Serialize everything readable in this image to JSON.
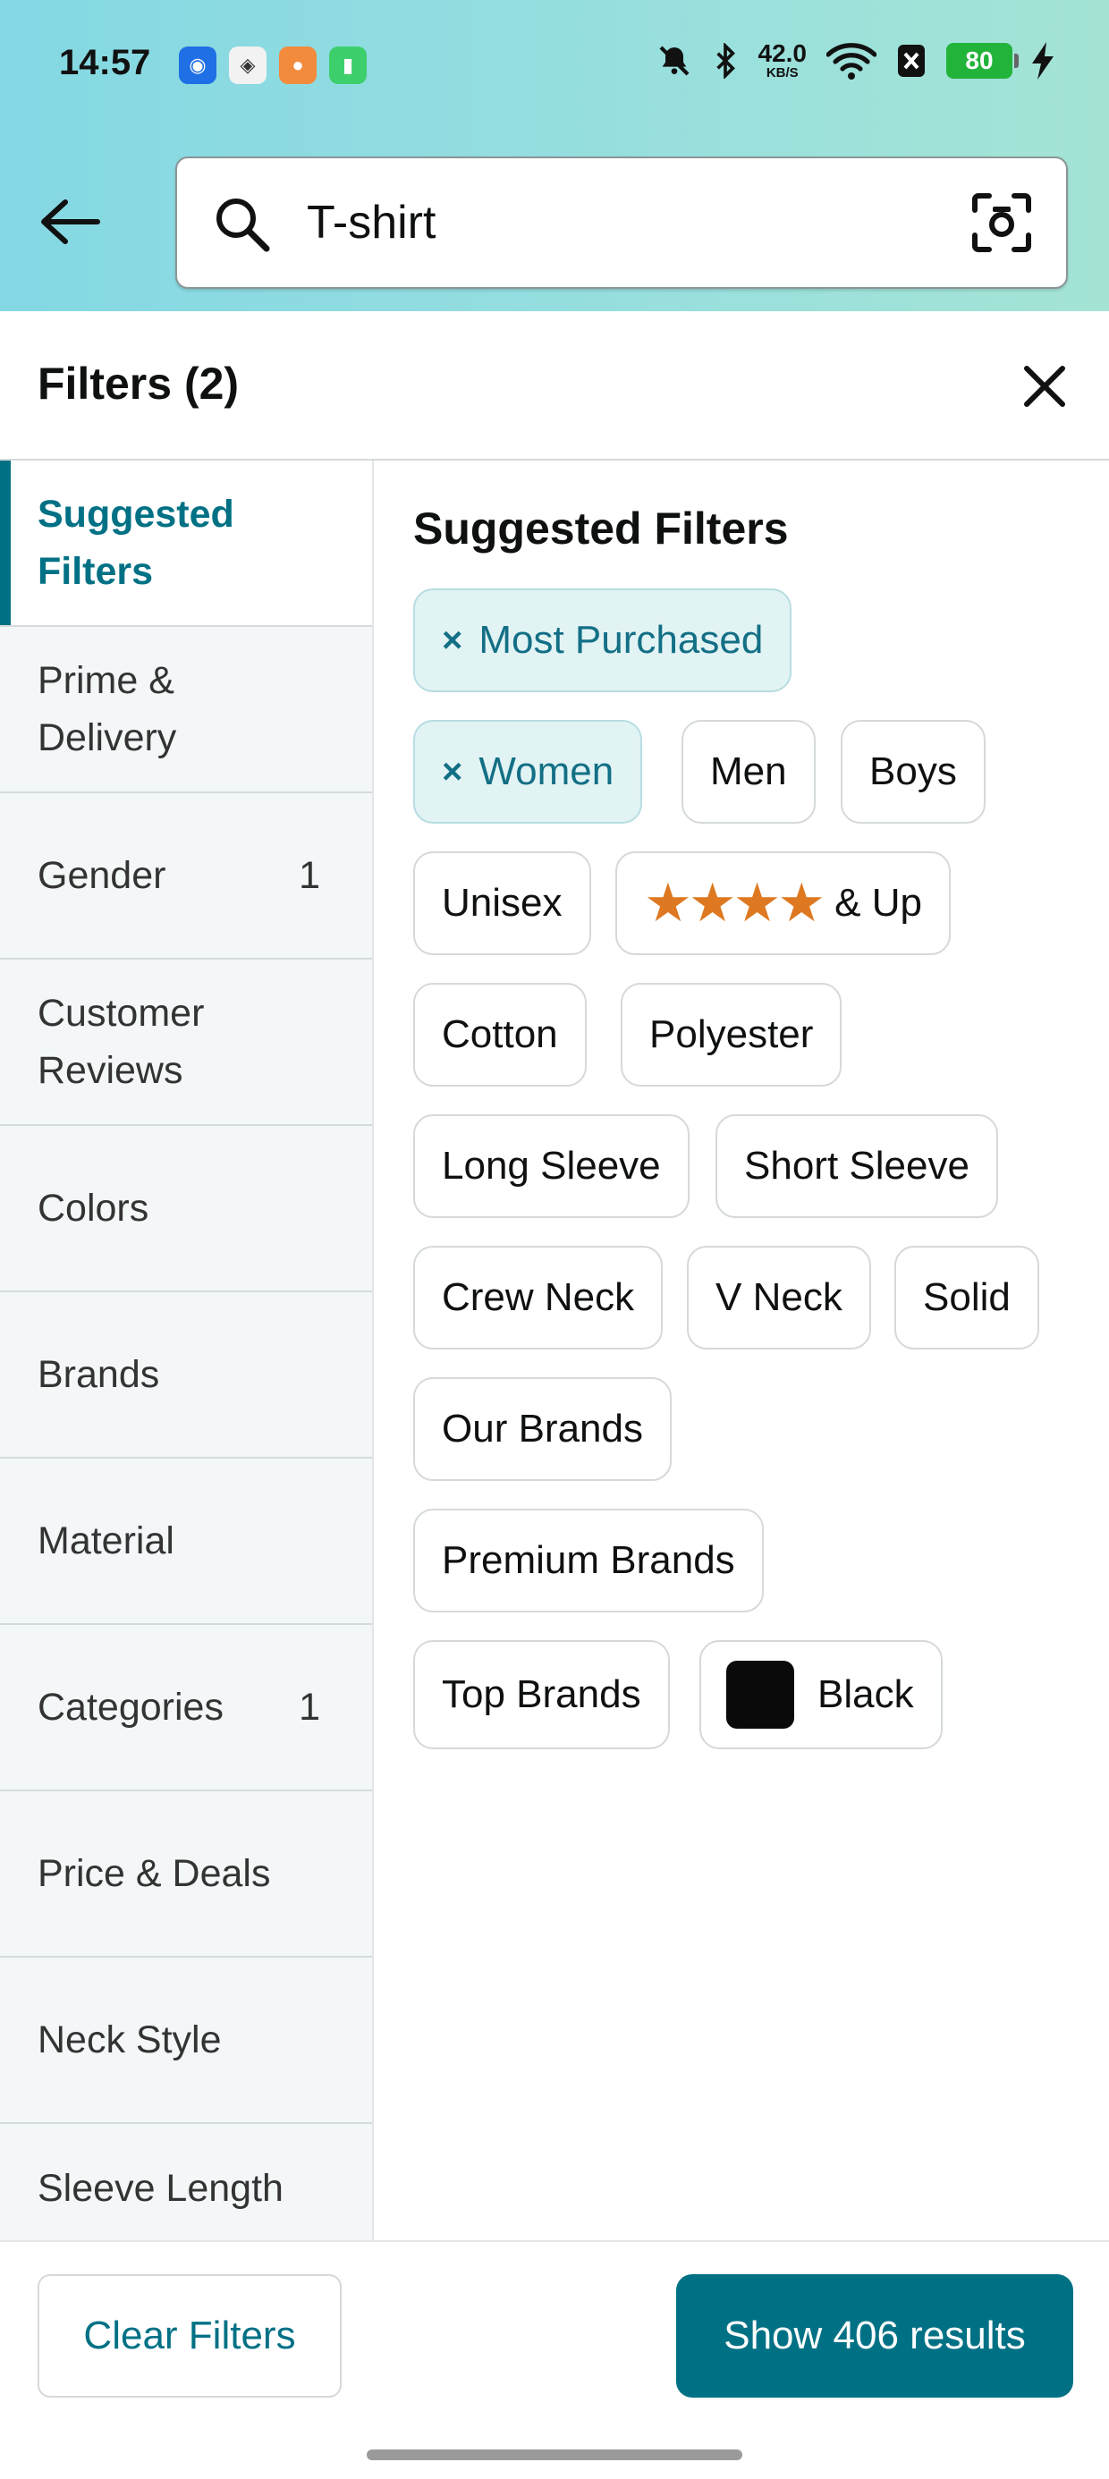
{
  "status_bar": {
    "time": "14:57",
    "speed_value": "42.0",
    "speed_unit": "KB/S",
    "battery": "80",
    "app_icons": [
      "blue-app-icon",
      "white-app-icon",
      "orange-app-icon",
      "green-app-icon"
    ]
  },
  "search": {
    "value": "T-shirt",
    "icon": "search-icon",
    "camera_icon": "camera-icon"
  },
  "filters_header": {
    "title": "Filters (2)"
  },
  "sidebar": {
    "items": [
      {
        "label": "Suggested Filters",
        "count": "",
        "active": true
      },
      {
        "label": "Prime & Delivery",
        "count": ""
      },
      {
        "label": "Gender",
        "count": "1"
      },
      {
        "label": "Customer Reviews",
        "count": ""
      },
      {
        "label": "Colors",
        "count": ""
      },
      {
        "label": "Brands",
        "count": ""
      },
      {
        "label": "Material",
        "count": ""
      },
      {
        "label": "Categories",
        "count": "1"
      },
      {
        "label": "Price & Deals",
        "count": ""
      },
      {
        "label": "Neck Style",
        "count": ""
      },
      {
        "label": "Sleeve Length",
        "count": ""
      }
    ]
  },
  "main": {
    "title": "Suggested Filters",
    "chips": {
      "most_purchased": "Most Purchased",
      "women": "Women",
      "men": "Men",
      "boys": "Boys",
      "unisex": "Unisex",
      "stars": "★★★★",
      "and_up": "& Up",
      "cotton": "Cotton",
      "polyester": "Polyester",
      "long_sleeve": "Long Sleeve",
      "short_sleeve": "Short Sleeve",
      "crew_neck": "Crew Neck",
      "v_neck": "V Neck",
      "solid": "Solid",
      "our_brands": "Our Brands",
      "premium_brands": "Premium Brands",
      "top_brands": "Top Brands",
      "black": "Black"
    },
    "remove_glyph": "×"
  },
  "bottom": {
    "clear": "Clear Filters",
    "show": "Show 406 results"
  },
  "colors": {
    "accent": "#007185",
    "selected_chip_bg": "#e2f3f4",
    "star": "#de7921",
    "swatch_black": "#0a0a0a"
  }
}
